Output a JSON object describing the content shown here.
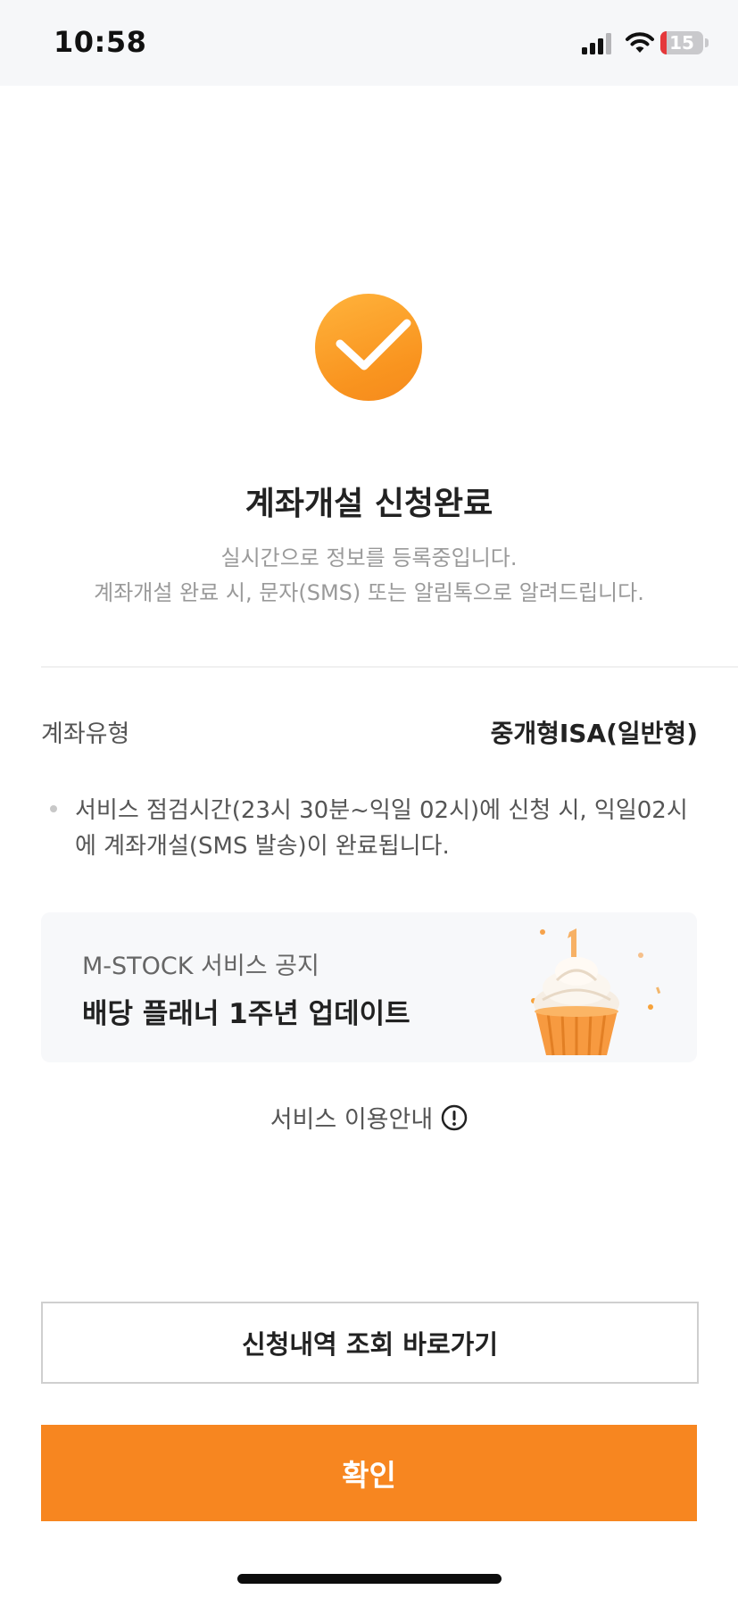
{
  "status_bar": {
    "time": "10:58",
    "battery_level": "15",
    "battery_fraction": 0.15,
    "battery_color": "#e5383b"
  },
  "result": {
    "icon": "check-icon",
    "accent_color": "#f9941f",
    "title": "계좌개설 신청완료",
    "subtitle_lines": [
      "실시간으로 정보를 등록중입니다.",
      "계좌개설 완료 시, 문자(SMS) 또는 알림톡으로 알려드립니다."
    ]
  },
  "account_info": {
    "label": "계좌유형",
    "value": "중개형ISA(일반형)"
  },
  "notice": {
    "text": "서비스 점검시간(23시 30분~익일 02시)에 신청 시, 익일02시에 계좌개설(SMS 발송)이  완료됩니다."
  },
  "banner": {
    "subtitle": "M-STOCK 서비스 공지",
    "title": "배당 플래너 1주년 업데이트",
    "image": "cupcake-icon"
  },
  "service_guide": {
    "label": "서비스 이용안내",
    "icon": "info-icon"
  },
  "buttons": {
    "history_label": "신청내역 조회 바로가기",
    "confirm_label": "확인",
    "confirm_color": "#f78620"
  }
}
